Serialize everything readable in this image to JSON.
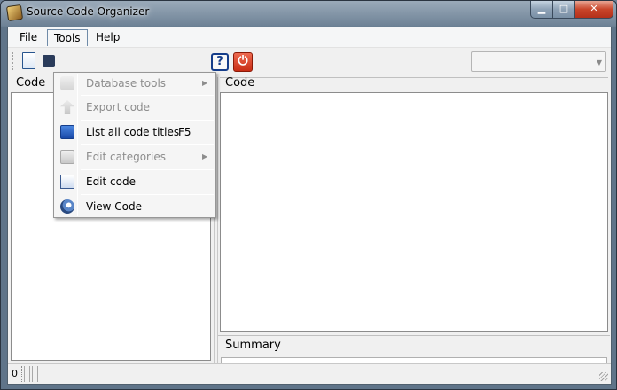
{
  "window": {
    "title": "Source Code Organizer",
    "min_glyph": "▁",
    "max_glyph": "□",
    "close_glyph": "✕"
  },
  "menubar": {
    "items": [
      "File",
      "Tools",
      "Help"
    ]
  },
  "toolbar": {
    "help_glyph": "?",
    "exit_glyph": "⏻",
    "combo_value": "",
    "combo_arrow": "▼"
  },
  "panes": {
    "left_label": "Code",
    "right_label": "Code",
    "summary_label": "Summary"
  },
  "status": {
    "value": "0"
  },
  "tools_menu": {
    "items": [
      {
        "label": "Database tools",
        "shortcut": "",
        "submenu": true,
        "enabled": false,
        "icon": "database-icon"
      },
      {
        "label": "Export code",
        "shortcut": "",
        "submenu": false,
        "enabled": false,
        "icon": "export-icon"
      },
      {
        "label": "List all code titles",
        "shortcut": "F5",
        "submenu": false,
        "enabled": true,
        "icon": "list-icon"
      },
      {
        "label": "Edit categories",
        "shortcut": "",
        "submenu": true,
        "enabled": false,
        "icon": "categories-icon"
      },
      {
        "label": "Edit code",
        "shortcut": "",
        "submenu": false,
        "enabled": true,
        "icon": "edit-icon"
      },
      {
        "label": "View Code",
        "shortcut": "",
        "submenu": false,
        "enabled": true,
        "icon": "view-icon"
      }
    ],
    "submenu_arrow": "▶"
  }
}
